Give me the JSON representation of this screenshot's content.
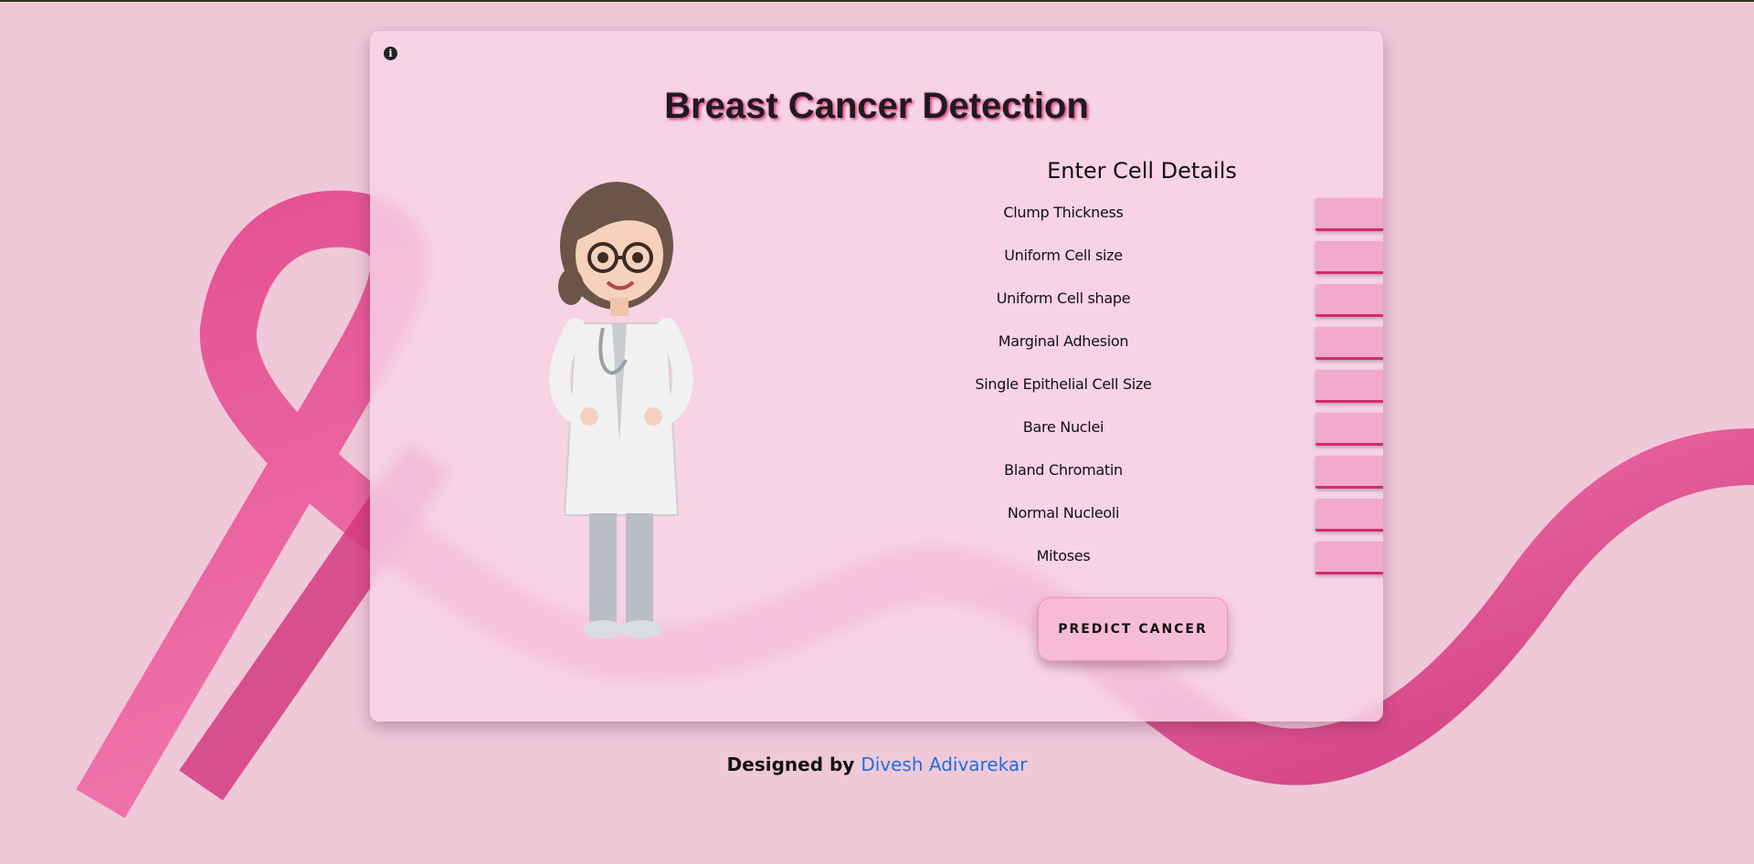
{
  "page": {
    "title": "Breast Cancer Detection",
    "info_icon": "info-circle-icon"
  },
  "form": {
    "heading": "Enter Cell Details",
    "fields": [
      {
        "label": "Clump Thickness",
        "value": ""
      },
      {
        "label": "Uniform Cell size",
        "value": ""
      },
      {
        "label": "Uniform Cell shape",
        "value": ""
      },
      {
        "label": "Marginal Adhesion",
        "value": ""
      },
      {
        "label": "Single Epithelial Cell Size",
        "value": ""
      },
      {
        "label": "Bare Nuclei",
        "value": ""
      },
      {
        "label": "Bland Chromatin",
        "value": ""
      },
      {
        "label": "Normal Nucleoli",
        "value": ""
      },
      {
        "label": "Mitoses",
        "value": ""
      }
    ],
    "submit_label": "PREDICT CANCER"
  },
  "footer": {
    "prefix": "Designed by",
    "author": "Divesh Adivarekar"
  },
  "colors": {
    "accent": "#d6296e",
    "field_bg": "#f1aacb",
    "link": "#1f6fe0"
  }
}
